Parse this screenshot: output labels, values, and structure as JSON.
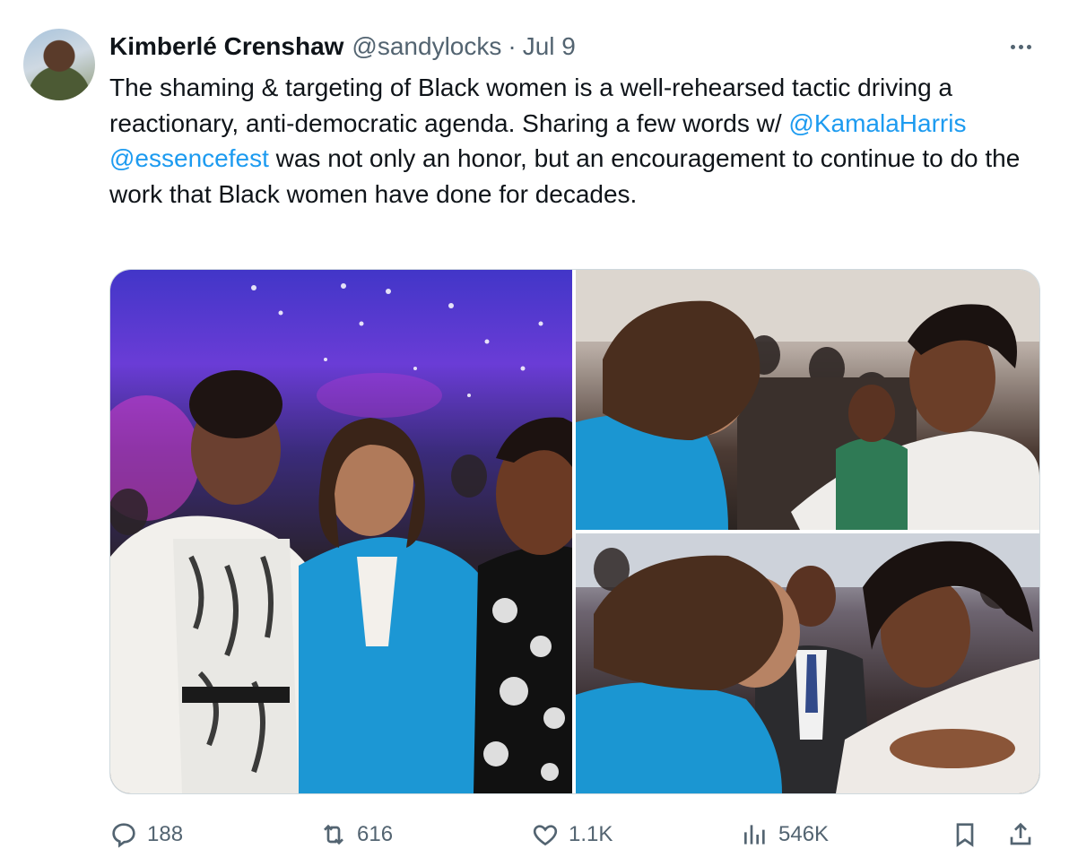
{
  "author": {
    "name": "Kimberlé Crenshaw",
    "handle": "@sandylocks",
    "separator": "·",
    "date": "Jul 9"
  },
  "tweet": {
    "text_part1": "The shaming & targeting of Black women is a well-rehearsed tactic driving a reactionary, anti-democratic agenda. Sharing a few words w/ ",
    "mention1": "@KamalaHarris",
    "space": " ",
    "mention2": "@essencefest",
    "text_part2": " was not only an honor, but an encouragement to continue to do the work that Black women have done for decades."
  },
  "media": {
    "photos": [
      {
        "name": "photo-group-event"
      },
      {
        "name": "photo-embrace-1"
      },
      {
        "name": "photo-embrace-2"
      }
    ]
  },
  "actions": {
    "replies": "188",
    "reposts": "616",
    "likes": "1.1K",
    "views": "546K"
  },
  "colors": {
    "text": "#0f1419",
    "secondary": "#536471",
    "link": "#1d9bf0",
    "border": "#cfd9de"
  },
  "icons": [
    "reply-icon",
    "repost-icon",
    "like-icon",
    "views-icon",
    "bookmark-icon",
    "share-icon",
    "more-icon"
  ]
}
